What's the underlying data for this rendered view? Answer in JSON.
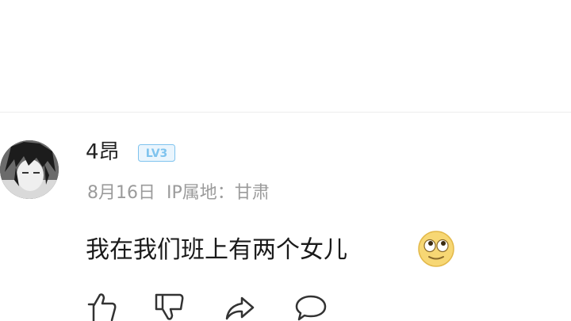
{
  "comment": {
    "username": "4昂",
    "level_badge": "LV3",
    "date": "8月16日",
    "ip_location": "IP属地：甘肃",
    "text": "我在我们班上有两个女儿",
    "emoji": "rolling-eyes-emoji"
  },
  "actions": [
    {
      "name": "like",
      "icon": "thumbs-up-icon"
    },
    {
      "name": "dislike",
      "icon": "thumbs-down-icon"
    },
    {
      "name": "share",
      "icon": "share-arrow-icon"
    },
    {
      "name": "reply",
      "icon": "comment-bubble-icon"
    }
  ],
  "colors": {
    "level_badge": "#7ec3ee",
    "text_primary": "#1a1a1a",
    "text_secondary": "#9b9b9b"
  }
}
